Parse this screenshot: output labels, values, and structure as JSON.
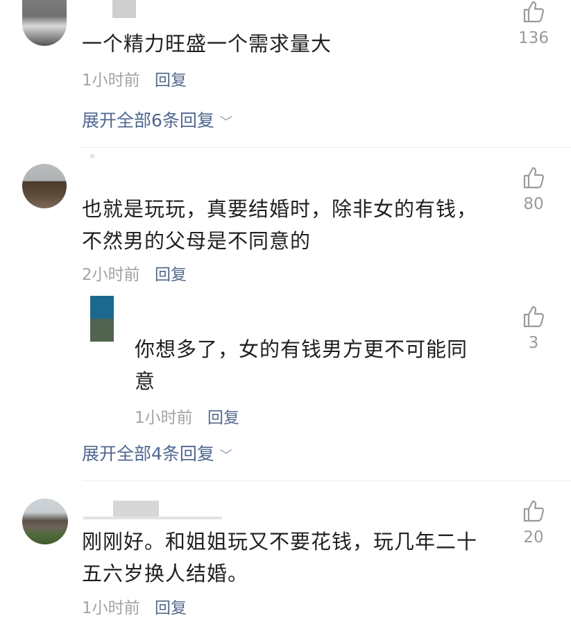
{
  "comments": [
    {
      "text": "一个精力旺盛一个需求量大",
      "time": "1小时前",
      "reply_label": "回复",
      "likes": "136",
      "expand_label": "展开全部6条回复"
    },
    {
      "text_line1": "也就是玩玩，真要结婚时，除非女的有钱，",
      "text_line2": "不然男的父母是不同意的",
      "time": "2小时前",
      "reply_label": "回复",
      "likes": "80",
      "sub_reply": {
        "text_line1": "你想多了，女的有钱男方更不可能同",
        "text_line2": "意",
        "time": "1小时前",
        "reply_label": "回复",
        "likes": "3"
      },
      "expand_label": "展开全部4条回复"
    },
    {
      "text_line1": "刚刚好。和姐姐玩又不要花钱，玩几年二十",
      "text_line2": "五六岁换人结婚。",
      "time": "1小时前",
      "reply_label": "回复",
      "likes": "20"
    }
  ],
  "icons": {
    "like": "thumbs-up-icon",
    "expand": "chevron-down-icon"
  },
  "colors": {
    "link": "#4f6690",
    "meta": "#a3a3a3",
    "text": "#1f1f1f"
  }
}
